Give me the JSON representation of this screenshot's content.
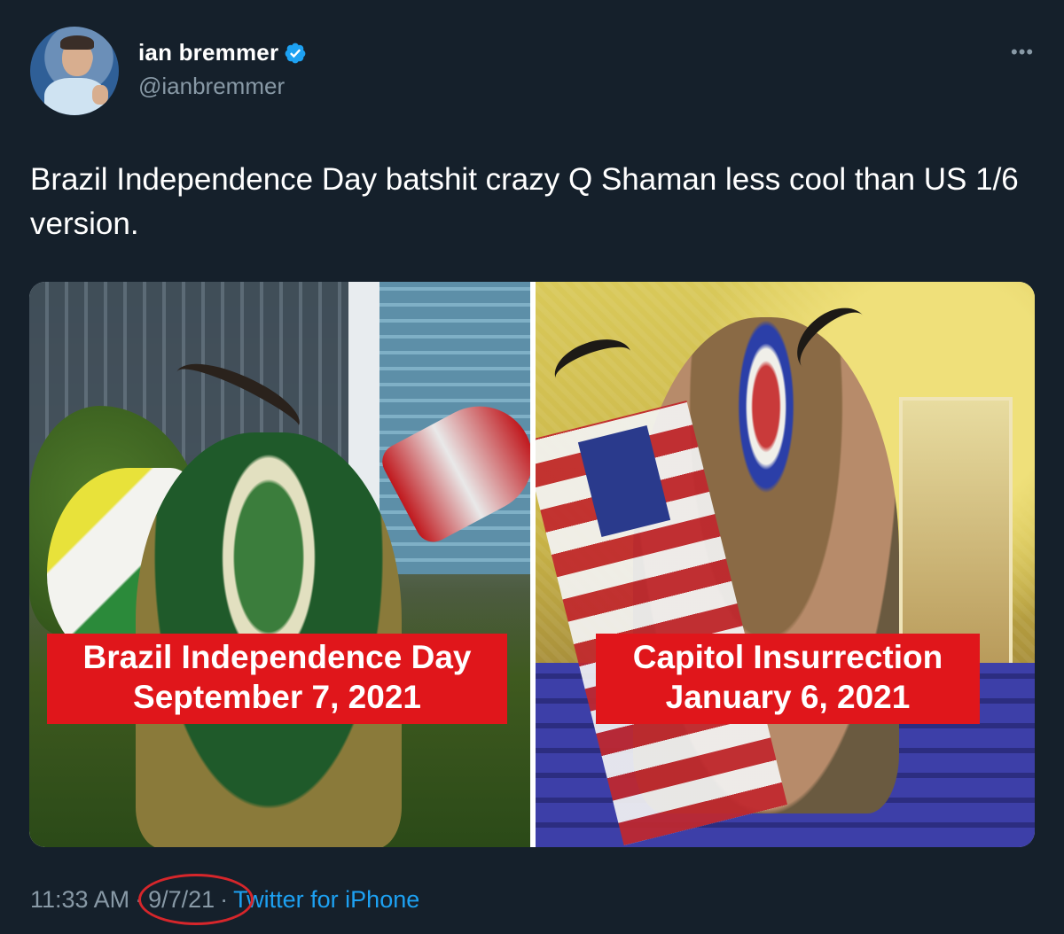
{
  "author": {
    "display_name": "ian bremmer",
    "handle": "@ianbremmer",
    "verified": true,
    "verified_color": "#1da1f2"
  },
  "more_icon": "more-horizontal-icon",
  "more_glyph": "•••",
  "tweet": {
    "text": "Brazil Independence Day batshit crazy Q Shaman less cool than US 1/6 version."
  },
  "media": {
    "left": {
      "caption_line1": "Brazil Independence Day",
      "caption_line2": "September 7, 2021"
    },
    "right": {
      "caption_line1": "Capitol Insurrection",
      "caption_line2": "January 6, 2021"
    },
    "caption_color": "#e0161b"
  },
  "meta": {
    "time": "11:33 AM",
    "separator": "·",
    "date": "9/7/21",
    "source": "Twitter for iPhone",
    "source_color": "#1da1f2",
    "annotation_color": "#d6262b"
  },
  "colors": {
    "background": "#15202b",
    "secondary_text": "#8899a6"
  }
}
